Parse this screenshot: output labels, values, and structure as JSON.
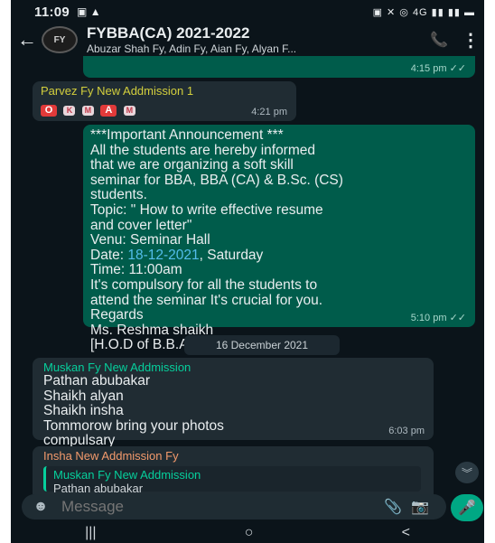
{
  "status_bar": {
    "time": "11:09",
    "icons": "▣ ▲",
    "right": "▣ ✕ ◎ 4G ▮▮ ▮▮ ▬"
  },
  "header": {
    "title": "FYBBA(CA) 2021-2022",
    "subtitle": "Abuzar Shah Fy, Adin Fy, Aian Fy, Alyan F...",
    "avatar_text": "FY"
  },
  "messages": [
    {
      "time": "4:15 pm",
      "ticks": "✓✓"
    },
    {
      "sender": "Parvez Fy New Addmission 1",
      "sender_color": "#d3cf3d",
      "reactions": [
        "O",
        "K",
        "M",
        "A",
        "M"
      ],
      "time": "4:21 pm"
    },
    {
      "text_before": "***Important Announcement ***\nAll the students are hereby informed\nthat we are organizing a soft skill\nseminar for BBA, BBA (CA) & B.Sc. (CS)\nstudents.\nTopic: \" How to write effective resume\nand cover letter\"\nVenu: Seminar Hall\nDate: ",
      "date": "18-12-2021",
      "text_after": ", Saturday\nTime: 11:00am\nIt's compulsory for all the students to\nattend the seminar It's crucial for you.\nRegards\nMs. Reshma shaikh\n[H.O.D of B.B.A.(CA) Department]",
      "time": "5:10 pm",
      "ticks": "✓✓"
    },
    {
      "sender": "Muskan Fy New Addmission",
      "sender_color": "#06cf9c",
      "text": "Pathan abubakar\nShaikh alyan\nShaikh insha\nTommorow bring your photos\ncompulsary",
      "time": "6:03 pm"
    },
    {
      "sender": "Insha New Addmission Fy",
      "sender_color": "#f39a6c",
      "quote_sender": "Muskan Fy New Addmission",
      "quote_text": "Pathan abubakar"
    }
  ],
  "date_chip": "16 December 2021",
  "input": {
    "placeholder": "Message"
  },
  "nav": {
    "recents": "|||",
    "home": "○",
    "back": "<"
  },
  "colors": {
    "background": "#0b141a",
    "outgoing": "#005c4b",
    "incoming": "#202c33",
    "accent": "#00a884"
  }
}
